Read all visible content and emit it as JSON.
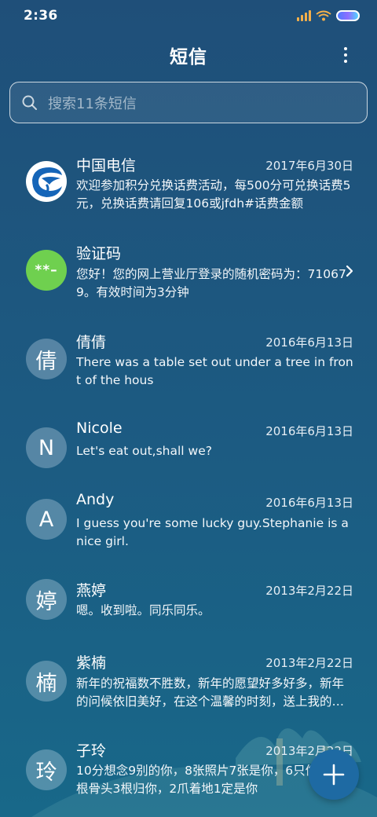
{
  "status_bar": {
    "time": "2:36"
  },
  "header": {
    "title": "短信"
  },
  "search": {
    "placeholder": "搜索11条短信"
  },
  "conversations": [
    {
      "name": "中国电信",
      "date": "2017年6月30日",
      "preview": "欢迎参加积分兑换话费活动，每500分可兑换话费5元，兑换话费请回复106或jfdh#话费金额",
      "avatar": "china-telecom-logo",
      "avatar_text": ""
    },
    {
      "name": "验证码",
      "date": "",
      "preview": "您好！您的网上营业厅登录的随机密码为：710679。有效时间为3分钟",
      "avatar": "code",
      "avatar_text": "**–"
    },
    {
      "name": "倩倩",
      "date": "2016年6月13日",
      "preview": "There was a table set out under a tree in front of the hous",
      "avatar_text": "倩"
    },
    {
      "name": "Nicole",
      "date": "2016年6月13日",
      "preview": "Let's eat out,shall we?",
      "avatar_text": "N"
    },
    {
      "name": "Andy",
      "date": "2016年6月13日",
      "preview": "I guess you're some lucky guy.Stephanie is a nice girl.",
      "avatar_text": "A"
    },
    {
      "name": "燕婷",
      "date": "2013年2月22日",
      "preview": "嗯。收到啦。同乐同乐。",
      "avatar_text": "婷"
    },
    {
      "name": "紫楠",
      "date": "2013年2月22日",
      "preview": "新年的祝福数不胜数，新年的愿望好多好多，新年的问候依旧美好，在这个温馨的时刻，送上我的祝福",
      "avatar_text": "楠"
    },
    {
      "name": "子玲",
      "date": "2013年2月22日",
      "preview": "10分想念9别的你，8张照片7张是你，6只像你，4根骨头3根归你，2爪着地1定是你",
      "avatar_text": "玲"
    }
  ],
  "colors": {
    "accent": "#1e6aa3",
    "code_avatar": "#6fd04f",
    "telecom_blue": "#1565b8"
  },
  "icons": {
    "search": "search-icon",
    "menu": "more-vertical-icon",
    "compose": "plus-icon",
    "chevron": "chevron-right-icon"
  }
}
